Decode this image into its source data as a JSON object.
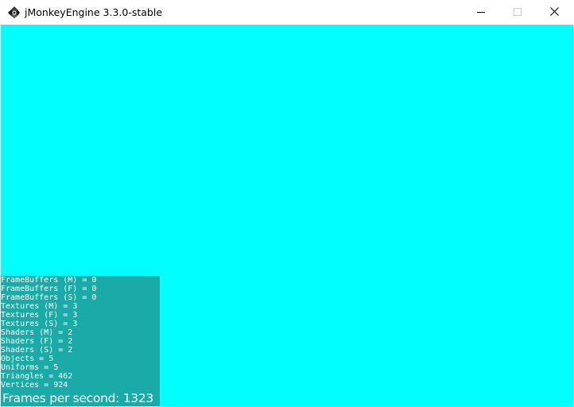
{
  "window": {
    "title": "jMonkeyEngine 3.3.0-stable",
    "icon": "jmonkey-logo-icon",
    "buttons": {
      "minimize": "minimize-icon",
      "maximize": "maximize-icon",
      "close": "close-icon"
    }
  },
  "viewport": {
    "background_color": "#00ffff",
    "stats_panel_color": "#1aaaa7"
  },
  "stats": [
    "FrameBuffers (M) = 0",
    "FrameBuffers (F) = 0",
    "FrameBuffers (S) = 0",
    "Textures (M) = 3",
    "Textures (F) = 3",
    "Textures (S) = 3",
    "Shaders (M) = 2",
    "Shaders (F) = 2",
    "Shaders (S) = 2",
    "Objects = 5",
    "Uniforms = 5",
    "Triangles = 462",
    "Vertices = 924"
  ],
  "fps_text": "Frames per second: 1323"
}
